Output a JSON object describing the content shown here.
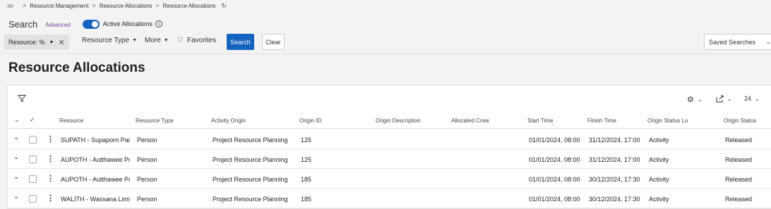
{
  "breadcrumb": {
    "items": [
      "Resource Management",
      "Resource Allocations",
      "Resource Allocations"
    ],
    "separator": ">",
    "refresh_icon": "refresh-icon"
  },
  "search": {
    "title": "Search",
    "advanced_label": "Advanced",
    "toggle_label": "Active Allocations",
    "toggle_on": true,
    "info_glyph": "i"
  },
  "filters": {
    "resource_chip": "Resource: %",
    "resource_type": "Resource Type",
    "more": "More",
    "favorites": "Favorites",
    "search_button": "Search",
    "clear_button": "Clear",
    "saved_searches": "Saved Searches"
  },
  "page": {
    "title": "Resource Allocations"
  },
  "toolbar": {
    "page_size": "24"
  },
  "table": {
    "columns": [
      "Resource",
      "Resource Type",
      "Activity Origin",
      "Origin ID",
      "Origin Description",
      "Allocated Crew",
      "Start Time",
      "Finish Time",
      "Origin Status Lu",
      "Origin Status"
    ],
    "rows": [
      {
        "resource": "SUPATH - Supaporn Pans",
        "type": "Person",
        "activity_origin": "Project Resource Planning",
        "origin_id": "125",
        "origin_description": "",
        "allocated_crew": "",
        "start": "01/01/2024, 08:00",
        "finish": "31/12/2024, 17:00",
        "status_lu": "Activity",
        "status": "Released"
      },
      {
        "resource": "AUPOTH - Autthawee Po",
        "type": "Person",
        "activity_origin": "Project Resource Planning",
        "origin_id": "125",
        "origin_description": "",
        "allocated_crew": "",
        "start": "01/01/2024, 08:00",
        "finish": "31/12/2024, 17:00",
        "status_lu": "Activity",
        "status": "Released"
      },
      {
        "resource": "AUPOTH - Autthawee Po",
        "type": "Person",
        "activity_origin": "Project Resource Planning",
        "origin_id": "185",
        "origin_description": "",
        "allocated_crew": "",
        "start": "01/01/2024, 08:00",
        "finish": "30/12/2024, 17:30",
        "status_lu": "Activity",
        "status": "Released"
      },
      {
        "resource": "WALITH - Wassana Limsa",
        "type": "Person",
        "activity_origin": "Project Resource Planning",
        "origin_id": "185",
        "origin_description": "",
        "allocated_crew": "",
        "start": "01/01/2024, 08:00",
        "finish": "30/12/2024, 17:30",
        "status_lu": "Activity",
        "status": "Released"
      }
    ]
  },
  "colors": {
    "accent": "#1464c0",
    "advanced": "#7a3e9d"
  }
}
